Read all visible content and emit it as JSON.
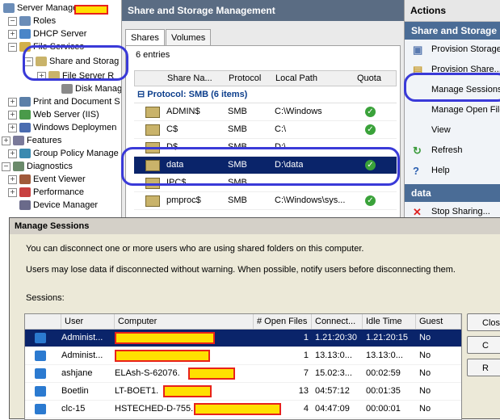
{
  "tree": {
    "root": "Server Manager",
    "items": [
      {
        "label": "Roles",
        "exp": "-"
      },
      {
        "label": "DHCP Server",
        "exp": "+"
      },
      {
        "label": "File Services",
        "exp": "-"
      },
      {
        "label": "Share and Storag",
        "exp": "-"
      },
      {
        "label": "File Server R",
        "exp": "+"
      },
      {
        "label": "Disk Manager",
        "exp": ""
      },
      {
        "label": "Print and Document S",
        "exp": "+"
      },
      {
        "label": "Web Server (IIS)",
        "exp": "+"
      },
      {
        "label": "Windows Deploymen",
        "exp": "+"
      },
      {
        "label": "Features",
        "exp": "+"
      },
      {
        "label": "Group Policy Manage",
        "exp": "+"
      },
      {
        "label": "Diagnostics",
        "exp": "-"
      },
      {
        "label": "Event Viewer",
        "exp": "+"
      },
      {
        "label": "Performance",
        "exp": "+"
      },
      {
        "label": "Device Manager",
        "exp": ""
      }
    ]
  },
  "center": {
    "title": "Share and Storage Management",
    "tabs": [
      "Shares",
      "Volumes"
    ],
    "entries": "6 entries",
    "columns": [
      "Share Na...",
      "Protocol",
      "Local Path",
      "Quota"
    ],
    "group": "Protocol: SMB (6 items)",
    "rows": [
      {
        "name": "ADMIN$",
        "protocol": "SMB",
        "path": "C:\\Windows",
        "quota": "✓"
      },
      {
        "name": "C$",
        "protocol": "SMB",
        "path": "C:\\",
        "quota": "✓"
      },
      {
        "name": "D$",
        "protocol": "SMB",
        "path": "D:\\",
        "quota": ""
      },
      {
        "name": "data",
        "protocol": "SMB",
        "path": "D:\\data",
        "quota": "✓"
      },
      {
        "name": "IPC$",
        "protocol": "SMB",
        "path": "",
        "quota": ""
      },
      {
        "name": "pmproc$",
        "protocol": "SMB",
        "path": "C:\\Windows\\sys...",
        "quota": "✓"
      }
    ]
  },
  "actions": {
    "header": "Actions",
    "section1": "Share and Storage",
    "items": [
      "Provision Storage",
      "Provision Share...",
      "Manage Sessions...",
      "Manage Open Files",
      "View",
      "Refresh",
      "Help"
    ],
    "section2": "data",
    "items2": [
      "Stop Sharing..."
    ]
  },
  "dialog": {
    "title": "Manage Sessions",
    "text1": "You can disconnect one or more users who are using shared folders on this computer.",
    "text2": "Users may lose data if disconnected without warning. When possible, notify users before disconnecting them.",
    "sessions_label": "Sessions:",
    "columns": [
      "User",
      "Computer",
      "# Open Files",
      "Connect...",
      "Idle Time",
      "Guest"
    ],
    "rows": [
      {
        "user": "Administ...",
        "computer": "",
        "open": "1",
        "connect": "1.21:20:30",
        "idle": "1.21:20:15",
        "guest": "No"
      },
      {
        "user": "Administ...",
        "computer": "",
        "open": "1",
        "connect": "13.13:0...",
        "idle": "13.13:0...",
        "guest": "No"
      },
      {
        "user": "ashjane",
        "computer": "ELAsh-S-62076.",
        "open": "7",
        "connect": "15.02:3...",
        "idle": "00:02:59",
        "guest": "No"
      },
      {
        "user": "Boetlin",
        "computer": "LT-BOET1.",
        "open": "13",
        "connect": "04:57:12",
        "idle": "00:01:35",
        "guest": "No"
      },
      {
        "user": "clc-15",
        "computer": "HSTECHED-D-755.",
        "open": "4",
        "connect": "04:47:09",
        "idle": "00:00:01",
        "guest": "No"
      }
    ],
    "buttons": [
      "Close",
      "C",
      "R"
    ]
  },
  "colors": {
    "highlight": "#0a246a",
    "annotation": "#3a3ad8",
    "redaction": "#ffe000"
  }
}
